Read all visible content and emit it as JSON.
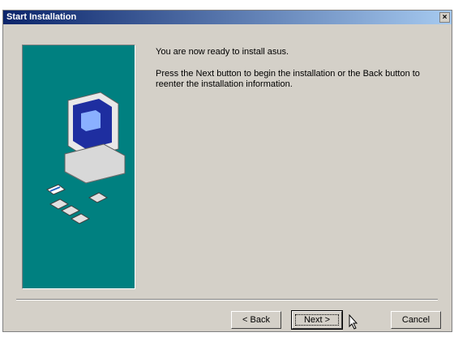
{
  "window": {
    "title": "Start Installation",
    "close_glyph": "×"
  },
  "content": {
    "line1": "You are now ready to install asus.",
    "line2": "Press the Next button to begin the installation or the Back button to reenter the installation information."
  },
  "buttons": {
    "back": "< Back",
    "next": "Next >",
    "cancel": "Cancel"
  },
  "icons": {
    "illustration": "computer-illustration",
    "cursor": "mouse-cursor-icon"
  }
}
